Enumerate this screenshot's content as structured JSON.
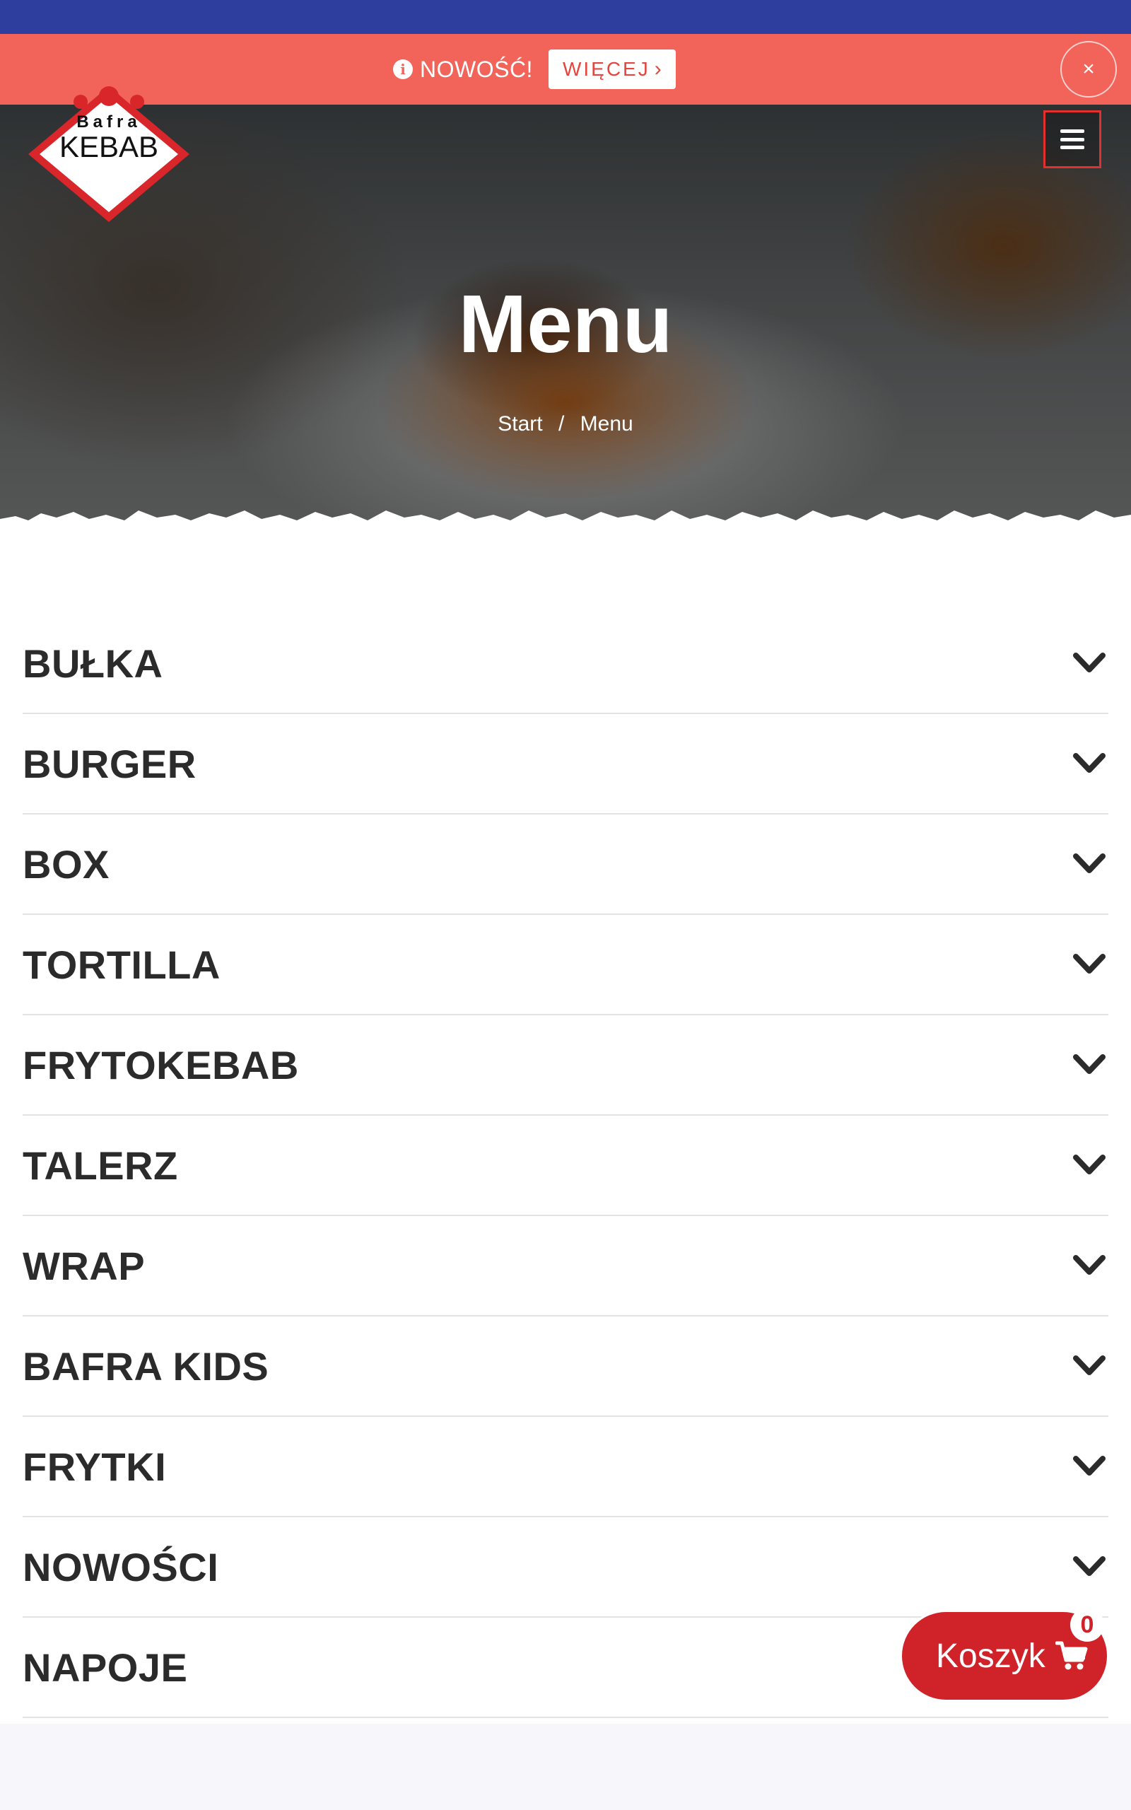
{
  "promo": {
    "label": "NOWOŚĆ!",
    "more_label": "WIĘCEJ",
    "more_chevron": "›",
    "close_label": "×",
    "info_icon": "info-icon",
    "background_color": "#f2645a"
  },
  "header": {
    "logo_text_top": "Bafra",
    "logo_text_main": "KEBAB",
    "menu_icon": "hamburger-icon"
  },
  "hero": {
    "title": "Menu",
    "breadcrumb": [
      {
        "label": "Start"
      },
      {
        "label": "Menu"
      }
    ],
    "breadcrumb_separator": "/"
  },
  "categories": [
    {
      "label": "BUŁKA"
    },
    {
      "label": "BURGER"
    },
    {
      "label": "BOX"
    },
    {
      "label": "TORTILLA"
    },
    {
      "label": "FRYTOKEBAB"
    },
    {
      "label": "TALERZ"
    },
    {
      "label": "WRAP"
    },
    {
      "label": "BAFRA KIDS"
    },
    {
      "label": "FRYTKI"
    },
    {
      "label": "NOWOŚCI"
    },
    {
      "label": "NAPOJE"
    }
  ],
  "cart": {
    "label": "Koszyk",
    "count": "0",
    "icon": "cart-icon",
    "color": "#cf2229"
  },
  "colors": {
    "top_strip": "#2e3e9e",
    "accent_red": "#e0312e"
  }
}
